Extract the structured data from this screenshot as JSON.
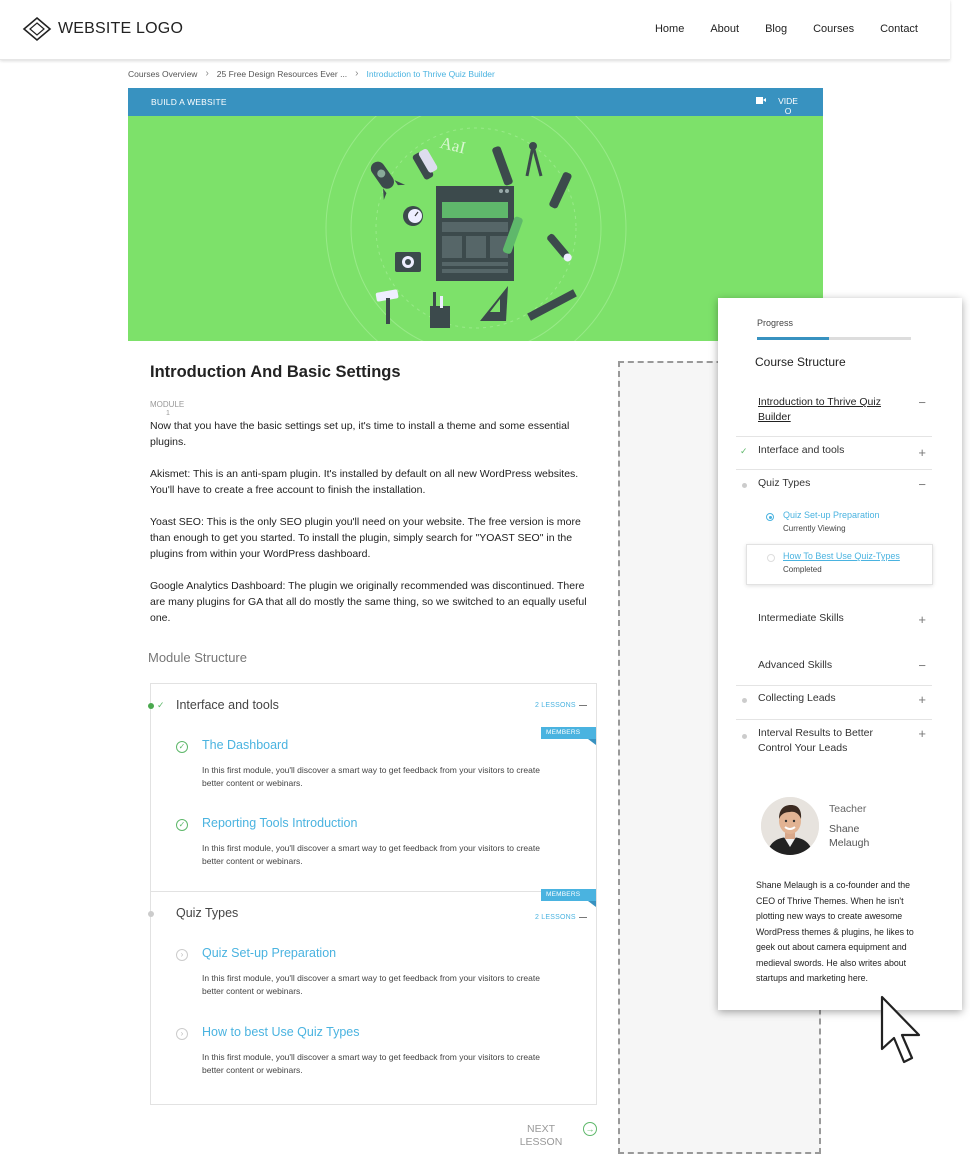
{
  "header": {
    "logo_text": "WEBSITE LOGO",
    "nav": [
      "Home",
      "About",
      "Blog",
      "Courses",
      "Contact"
    ]
  },
  "breadcrumb": {
    "items": [
      "Courses Overview",
      "25 Free Design Resources Ever ...",
      "Introduction to Thrive Quiz Builder"
    ]
  },
  "hero": {
    "label": "BUILD A WEBSITE",
    "video_label": "VIDEO",
    "bg_color": "#7de16a",
    "bar_color": "#3892c0",
    "art_text": "AaI"
  },
  "lesson": {
    "title": "Introduction And Basic Settings",
    "module_label": "MODULE",
    "module_number": "1",
    "paragraphs": [
      "Now that you have the basic settings set up, it's time to install a theme and some essential plugins.",
      "Akismet: This is an anti-spam plugin. It's installed by default on all new WordPress websites. You'll have to create a free account to finish the installation.",
      "Yoast SEO: This is the only SEO plugin you'll need on your website. The free version is more than enough to get you started. To install the plugin, simply search for \"YOAST SEO\" in the plugins from within your WordPress dashboard.",
      "Google Analytics Dashboard: The plugin we originally recommended was discontinued. There are many plugins for GA that all do mostly the same thing, so we switched to an equally useful one."
    ]
  },
  "module_structure": {
    "title": "Module Structure",
    "badge": "MEMBERS ONLY",
    "groups": [
      {
        "title": "Interface and tools",
        "count": "2 LESSONS",
        "lessons": [
          {
            "title": "The Dashboard",
            "desc": "In this first module, you'll discover a smart way to get feedback from your visitors to create better content or webinars."
          },
          {
            "title": "Reporting Tools Introduction",
            "desc": "In this first module, you'll discover a smart way to get feedback from your visitors to create better content or webinars."
          }
        ]
      },
      {
        "title": "Quiz Types",
        "count": "2 LESSONS",
        "lessons": [
          {
            "title": "Quiz Set-up Preparation",
            "desc": "In this first module, you'll discover a smart way to get feedback from your visitors to create better content or webinars."
          },
          {
            "title": "How to best Use Quiz Types",
            "desc": "In this first module, you'll discover a smart way to get feedback from your visitors to create better content or webinars."
          }
        ]
      }
    ],
    "next_label": "NEXT LESSON"
  },
  "sidebar": {
    "progress_label": "Progress",
    "progress_value": 0.47,
    "course_structure_title": "Course Structure",
    "items": [
      {
        "label": "Introduction to Thrive Quiz Builder",
        "sign": "−"
      },
      {
        "label": "Interface and tools",
        "sign": "+"
      },
      {
        "label": "Quiz Types",
        "sign": "−"
      },
      {
        "label": "Intermediate Skills",
        "sign": "+"
      },
      {
        "label": "Advanced Skills",
        "sign": "−"
      },
      {
        "label": "Collecting Leads",
        "sign": "+"
      },
      {
        "label": "Interval Results to Better Control Your Leads",
        "sign": "+"
      }
    ],
    "sub_items": [
      {
        "title": "Quiz Set-up Preparation",
        "status": "Currently Viewing"
      },
      {
        "title": "How To Best Use Quiz-Types",
        "status": "Completed"
      }
    ],
    "teacher_label": "Teacher",
    "teacher_name": "Shane Melaugh",
    "bio": "Shane Melaugh is a co-founder and the CEO of Thrive Themes. When he isn't plotting new ways to create awesome WordPress themes & plugins, he likes to geek out about camera equipment and medieval swords. He also writes about startups and marketing here."
  },
  "colors": {
    "accent": "#4ab3e0",
    "brand_blue": "#3892c0",
    "success": "#5fb86b"
  }
}
